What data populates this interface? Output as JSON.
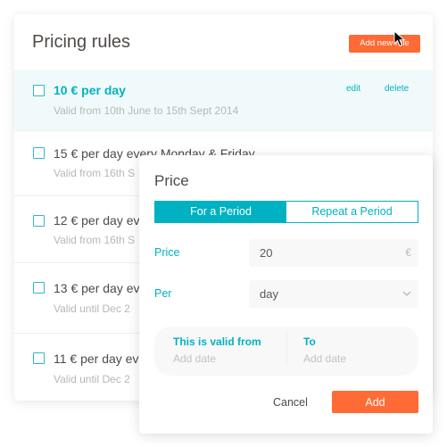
{
  "header": {
    "title": "Pricing rules",
    "add_button": "Add new rule"
  },
  "rules": [
    {
      "title": "10 € per day",
      "subtitle": "Valid from 10th June to 15th Sept 2014",
      "edit": "edit",
      "delete": "delete"
    },
    {
      "title": "15 € per day every Monday & Friday",
      "subtitle": "Valid from 16th S"
    },
    {
      "title": "12 € per day ev",
      "subtitle": "Valid from 16th S"
    },
    {
      "title": "13 € per day ev",
      "subtitle": "Valid until Dec 2"
    },
    {
      "title": "11 € per day ev",
      "subtitle": "Valid until Dec 2"
    }
  ],
  "modal": {
    "title": "Price",
    "tabs": [
      {
        "label": "For a Period",
        "active": true
      },
      {
        "label": "Repeat a Period",
        "active": false
      }
    ],
    "price_label": "Price",
    "price_value": "20",
    "currency": "€",
    "per_label": "Per",
    "per_value": "day",
    "from_label": "This is valid from",
    "from_placeholder": "Add date",
    "to_label": "To",
    "to_placeholder": "Add date",
    "cancel": "Cancel",
    "add": "Add"
  },
  "colors": {
    "accent": "#00b2c1",
    "primary_button": "#ff6a35",
    "text": "#4f4a47"
  }
}
